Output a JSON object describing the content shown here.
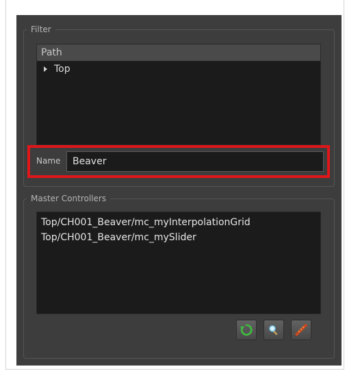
{
  "filter": {
    "title": "Filter",
    "tree_header": "Path",
    "tree_items": [
      {
        "label": "Top"
      }
    ],
    "name_label": "Name",
    "name_value": "Beaver"
  },
  "master_controllers": {
    "title": "Master Controllers",
    "items": [
      "Top/CH001_Beaver/mc_myInterpolationGrid",
      "Top/CH001_Beaver/mc_mySlider"
    ],
    "buttons": [
      {
        "icon": "refresh-icon"
      },
      {
        "icon": "select-icon"
      },
      {
        "icon": "ruler-icon"
      }
    ]
  },
  "colors": {
    "highlight": "#e0161b",
    "refresh": "#3fbf3f"
  }
}
